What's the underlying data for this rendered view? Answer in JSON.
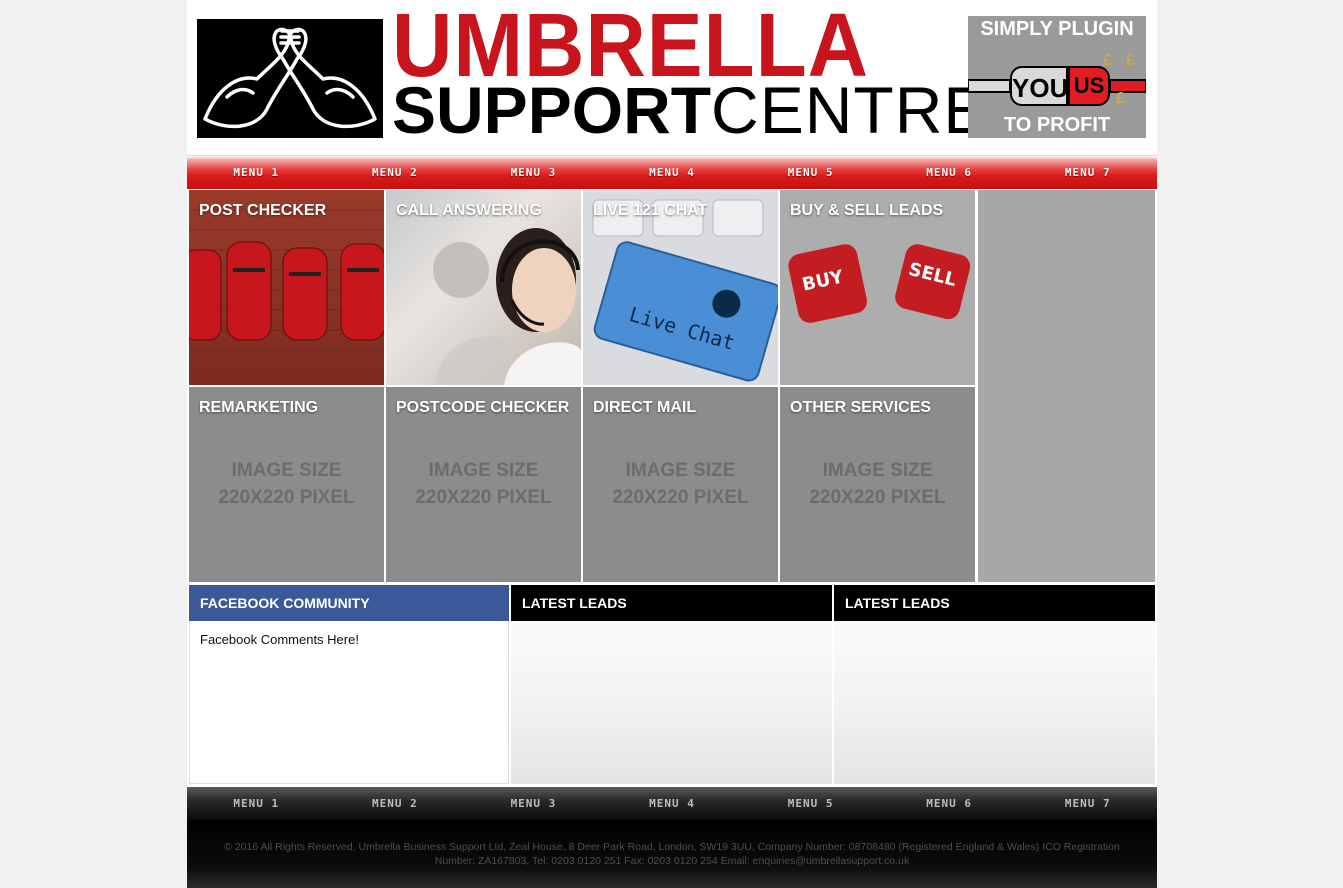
{
  "header": {
    "brand_top": "UMBRELLA",
    "brand_bottom_bold": "SUPPORT",
    "brand_bottom_light": "CENTRE",
    "ad": {
      "top_text": "SIMPLY PLUGIN",
      "left_plug": "YOU",
      "right_plug": "US",
      "bottom_text": "TO PROFIT",
      "pound": "£"
    }
  },
  "menu_top": [
    "MENU 1",
    "MENU 2",
    "MENU 3",
    "MENU 4",
    "MENU 5",
    "MENU 6",
    "MENU 7"
  ],
  "tiles": [
    {
      "label": "POST CHECKER",
      "image": "post-boxes"
    },
    {
      "label": "CALL ANSWERING",
      "image": "headset-agent"
    },
    {
      "label": "LIVE 121 CHAT",
      "image": "live-chat-key"
    },
    {
      "label": "BUY & SELL LEADS",
      "image": "buy-sell-dice"
    },
    {
      "label": "REMARKETING",
      "placeholder": [
        "IMAGE SIZE",
        "220X220 PIXEL"
      ]
    },
    {
      "label": "POSTCODE CHECKER",
      "placeholder": [
        "IMAGE SIZE",
        "220X220 PIXEL"
      ]
    },
    {
      "label": "DIRECT MAIL",
      "placeholder": [
        "IMAGE SIZE",
        "220X220 PIXEL"
      ]
    },
    {
      "label": "OTHER SERVICES",
      "placeholder": [
        "IMAGE SIZE",
        "220X220 PIXEL"
      ]
    }
  ],
  "panels": {
    "facebook": {
      "title": "FACEBOOK COMMUNITY",
      "body": "Facebook Comments Here!"
    },
    "leads_1": {
      "title": "LATEST LEADS"
    },
    "leads_2": {
      "title": "LATEST LEADS"
    }
  },
  "menu_bottom": [
    "MENU 1",
    "MENU 2",
    "MENU 3",
    "MENU 4",
    "MENU 5",
    "MENU 6",
    "MENU 7"
  ],
  "footer": {
    "text": "© 2016 All Rights Reserved, Umbrella Business Support Ltd, Zeal House, 8 Deer Park Road, London, SW19 3UU. Company Number: 08708480 (Registered England & Wales) ICO Registration Number: ZA167803, Tel: 0203 0120 251 Fax: 0203 0120 254 Email: enquiries@umbrellasupport.co.uk"
  },
  "colors": {
    "brand_red": "#c8141c",
    "menu_red": "#d91c1c",
    "facebook_blue": "#3b5998",
    "tile_gray": "#8c8c8c"
  }
}
